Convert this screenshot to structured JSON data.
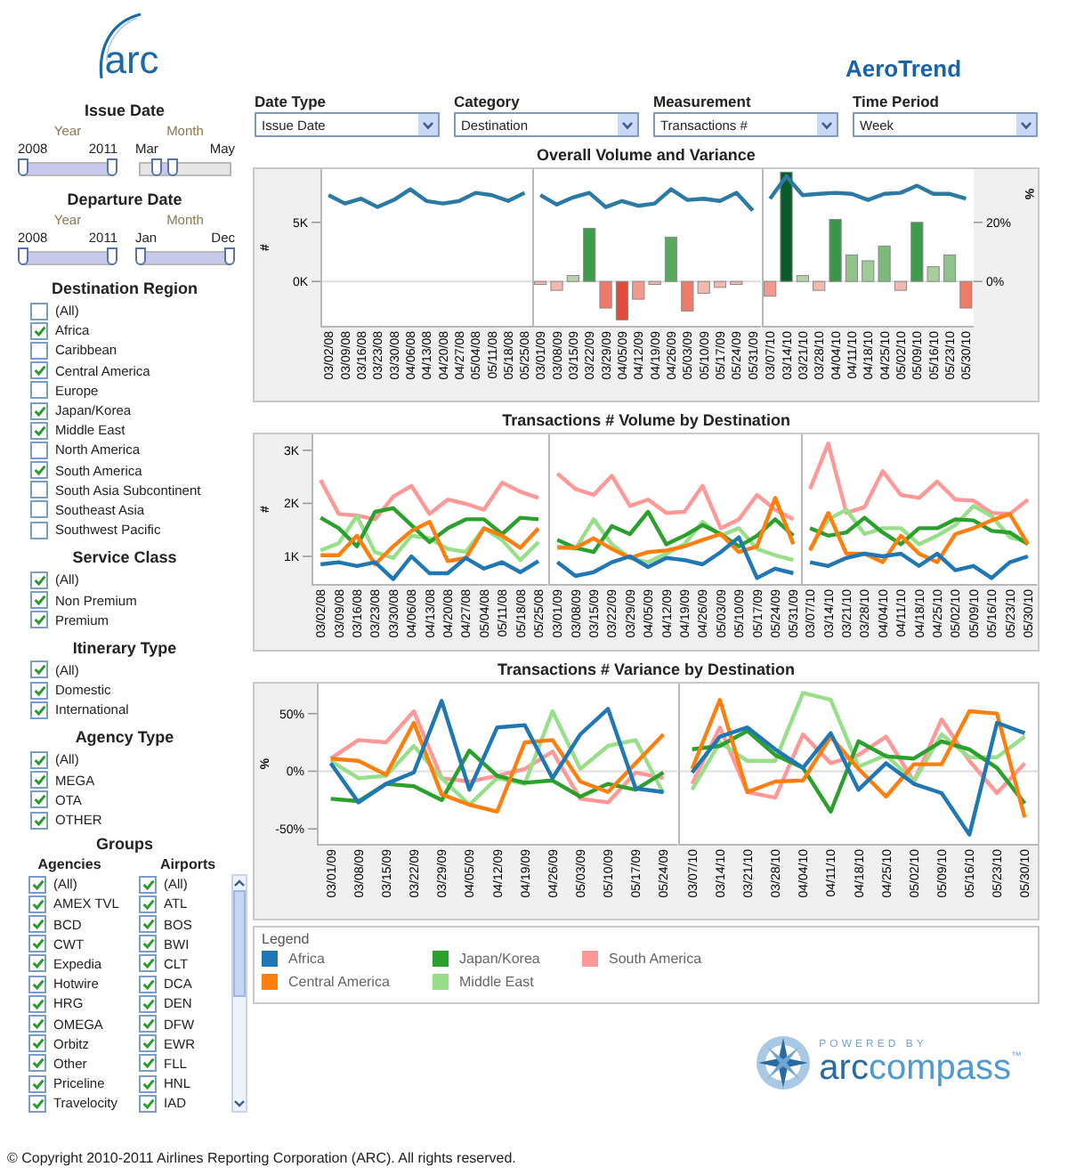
{
  "logo": {
    "text": "arc"
  },
  "app_title": "AeroTrend",
  "sidebar": {
    "date_filters": [
      {
        "title": "Issue Date",
        "sliders": [
          {
            "label": "Year",
            "min_label": "2008",
            "max_label": "2011",
            "thumbs": [
              {
                "level": 0
              },
              {
                "level": 1
              }
            ]
          },
          {
            "label": "Month",
            "min_label": "Mar",
            "max_label": "May",
            "thumbs": [
              {
                "level": 0.18
              },
              {
                "level": 0.36
              }
            ]
          }
        ]
      },
      {
        "title": "Departure Date",
        "sliders": [
          {
            "label": "Year",
            "min_label": "2008",
            "max_label": "2011",
            "thumbs": [
              {
                "level": 0
              },
              {
                "level": 1
              }
            ]
          },
          {
            "label": "Month",
            "min_label": "Jan",
            "max_label": "Dec",
            "thumbs": [
              {
                "level": 0
              },
              {
                "level": 1
              }
            ]
          }
        ]
      }
    ],
    "filters": [
      {
        "title": "Destination Region",
        "items": [
          {
            "label": "(All)",
            "checked": false
          },
          {
            "label": "Africa",
            "checked": true
          },
          {
            "label": "Caribbean",
            "checked": false
          },
          {
            "label": "Central America",
            "checked": true
          },
          {
            "label": "Europe",
            "checked": false
          },
          {
            "label": "Japan/Korea",
            "checked": true
          },
          {
            "label": "Middle East",
            "checked": true
          },
          {
            "label": "North America",
            "checked": false
          },
          {
            "label": "South America",
            "checked": true
          },
          {
            "label": "South Asia Subcontinent",
            "checked": false
          },
          {
            "label": "Southeast Asia",
            "checked": false
          },
          {
            "label": "Southwest Pacific",
            "checked": false
          }
        ]
      },
      {
        "title": "Service Class",
        "items": [
          {
            "label": "(All)",
            "checked": true
          },
          {
            "label": "Non Premium",
            "checked": true
          },
          {
            "label": "Premium",
            "checked": true
          }
        ]
      },
      {
        "title": "Itinerary Type",
        "items": [
          {
            "label": "(All)",
            "checked": true
          },
          {
            "label": "Domestic",
            "checked": true
          },
          {
            "label": "International",
            "checked": true
          }
        ]
      },
      {
        "title": "Agency Type",
        "items": [
          {
            "label": "(All)",
            "checked": true
          },
          {
            "label": "MEGA",
            "checked": true
          },
          {
            "label": "OTA",
            "checked": true
          },
          {
            "label": "OTHER",
            "checked": true
          }
        ]
      }
    ],
    "groups": {
      "title": "Groups",
      "columns": [
        {
          "title": "Agencies",
          "scrollable": false,
          "items": [
            {
              "label": "(All)",
              "checked": true
            },
            {
              "label": "AMEX TVL",
              "checked": true
            },
            {
              "label": "BCD",
              "checked": true
            },
            {
              "label": "CWT",
              "checked": true
            },
            {
              "label": "Expedia",
              "checked": true
            },
            {
              "label": "Hotwire",
              "checked": true
            },
            {
              "label": "HRG",
              "checked": true
            },
            {
              "label": "OMEGA",
              "checked": true
            },
            {
              "label": "Orbitz",
              "checked": true
            },
            {
              "label": "Other",
              "checked": true
            },
            {
              "label": "Priceline",
              "checked": true
            },
            {
              "label": "Travelocity",
              "checked": true
            }
          ]
        },
        {
          "title": "Airports",
          "scrollable": true,
          "items": [
            {
              "label": "(All)",
              "checked": true
            },
            {
              "label": "ATL",
              "checked": true
            },
            {
              "label": "BOS",
              "checked": true
            },
            {
              "label": "BWI",
              "checked": true
            },
            {
              "label": "CLT",
              "checked": true
            },
            {
              "label": "DCA",
              "checked": true
            },
            {
              "label": "DEN",
              "checked": true
            },
            {
              "label": "DFW",
              "checked": true
            },
            {
              "label": "EWR",
              "checked": true
            },
            {
              "label": "FLL",
              "checked": true
            },
            {
              "label": "HNL",
              "checked": true
            },
            {
              "label": "IAD",
              "checked": true
            }
          ]
        }
      ]
    }
  },
  "dropdowns": [
    {
      "label": "Date Type",
      "value": "Issue Date"
    },
    {
      "label": "Category",
      "value": "Destination"
    },
    {
      "label": "Measurement",
      "value": "Transactions #"
    },
    {
      "label": "Time Period",
      "value": "Week"
    }
  ],
  "charts": [
    {
      "title": "Overall Volume and Variance",
      "panels": [
        {
          "chart_data": {
            "type": "line",
            "ylabel": "#",
            "ylim": [
              -3.75,
              9.5
            ],
            "yticks": [
              {
                "value": 0,
                "label": "0K"
              },
              {
                "value": 5,
                "label": "5K"
              }
            ],
            "categories": [
              "03/02/08",
              "03/09/08",
              "03/16/08",
              "03/23/08",
              "03/30/08",
              "04/06/08",
              "04/13/08",
              "04/20/08",
              "04/27/08",
              "05/04/08",
              "05/11/08",
              "05/18/08",
              "05/25/08"
            ],
            "series": [
              {
                "color": "#2a7aa3",
                "values": [
                  7.3,
                  6.6,
                  7.0,
                  6.3,
                  6.9,
                  7.8,
                  6.8,
                  6.6,
                  6.8,
                  7.5,
                  7.3,
                  6.8,
                  7.5
                ]
              }
            ]
          }
        },
        {
          "chart_data": {
            "type": "bar",
            "ylim": [
              -3.75,
              9.5
            ],
            "y2lim": [
              -15,
              38
            ],
            "categories": [
              "03/01/09",
              "03/08/09",
              "03/15/09",
              "03/22/09",
              "03/29/09",
              "04/05/09",
              "04/12/09",
              "04/19/09",
              "04/26/09",
              "05/03/09",
              "05/10/09",
              "05/17/09",
              "05/24/09",
              "05/31/09"
            ],
            "series": [
              {
                "axis": "y2",
                "values": [
                  -1,
                  -3,
                  2,
                  18,
                  -9,
                  -13,
                  -6,
                  -1,
                  15,
                  -10,
                  -4,
                  -2,
                  -1,
                  null
                ],
                "colors": [
                  "#f2b8b0",
                  "#f2b8b0",
                  "#b5d3a8",
                  "#3f9b4c",
                  "#f07a6a",
                  "#e04b3a",
                  "#f29a8e",
                  "#f2b8b0",
                  "#58a85f",
                  "#f07a6a",
                  "#f2b8b0",
                  "#f2b8b0",
                  "#f2b8b0",
                  null
                ]
              },
              {
                "type": "line",
                "color": "#2a7aa3",
                "values": [
                  7.3,
                  6.5,
                  7.1,
                  7.5,
                  6.3,
                  6.8,
                  6.4,
                  6.6,
                  7.8,
                  6.9,
                  7.0,
                  6.8,
                  7.5,
                  6.0
                ]
              }
            ]
          }
        },
        {
          "chart_data": {
            "type": "bar",
            "ylim": [
              -3.75,
              9.5
            ],
            "y2lim": [
              -15,
              38
            ],
            "y2label": "%",
            "y2ticks": [
              {
                "value": 0,
                "label": "0%"
              },
              {
                "value": 20,
                "label": "20%"
              }
            ],
            "categories": [
              "03/07/10",
              "03/14/10",
              "03/21/10",
              "03/28/10",
              "04/04/10",
              "04/11/10",
              "04/18/10",
              "04/25/10",
              "05/02/10",
              "05/09/10",
              "05/16/10",
              "05/23/10",
              "05/30/10"
            ],
            "series": [
              {
                "axis": "y2",
                "values": [
                  -5,
                  37,
                  2,
                  -3,
                  21,
                  9,
                  7,
                  12,
                  -3,
                  20,
                  5,
                  9,
                  -9
                ],
                "colors": [
                  "#f29a8e",
                  "#0b5a2a",
                  "#b5d3a8",
                  "#f2b8b0",
                  "#3a964a",
                  "#8fc38a",
                  "#9ccb95",
                  "#7cb97a",
                  "#f2b8b0",
                  "#3f9b4c",
                  "#a8cf9a",
                  "#8fc38a",
                  "#f07a6a"
                ]
              },
              {
                "type": "line",
                "color": "#2a7aa3",
                "values": [
                  7.0,
                  8.9,
                  7.3,
                  7.4,
                  7.5,
                  7.4,
                  6.9,
                  7.4,
                  7.5,
                  8.1,
                  7.4,
                  7.4,
                  7.0
                ]
              }
            ]
          }
        }
      ]
    },
    {
      "title": "Transactions # Volume by Destination",
      "panels": [
        {
          "chart_data": {
            "type": "line",
            "ylabel": "#",
            "ylim": [
              0.48,
              3.3
            ],
            "yticks": [
              {
                "value": 1,
                "label": "1K"
              },
              {
                "value": 2,
                "label": "2K"
              },
              {
                "value": 3,
                "label": "3K"
              }
            ],
            "categories": [
              "03/02/08",
              "03/09/08",
              "03/16/08",
              "03/23/08",
              "03/30/08",
              "04/06/08",
              "04/13/08",
              "04/20/08",
              "04/27/08",
              "05/04/08",
              "05/11/08",
              "05/18/08",
              "05/25/08"
            ],
            "series": [
              {
                "color": "#ff9896",
                "values": [
                  2.44,
                  1.8,
                  1.77,
                  1.7,
                  2.13,
                  2.33,
                  1.8,
                  2.07,
                  1.99,
                  1.88,
                  2.39,
                  2.22,
                  2.1
                ]
              },
              {
                "color": "#98df8a",
                "values": [
                  1.11,
                  1.25,
                  1.76,
                  1.08,
                  0.97,
                  1.39,
                  1.34,
                  1.14,
                  1.08,
                  1.53,
                  1.31,
                  0.93,
                  1.27
                ]
              },
              {
                "color": "#2ca02c",
                "values": [
                  1.73,
                  1.53,
                  1.19,
                  1.84,
                  1.91,
                  1.59,
                  1.27,
                  1.53,
                  1.7,
                  1.7,
                  1.42,
                  1.73,
                  1.7
                ]
              },
              {
                "color": "#ff7f0e",
                "values": [
                  1.02,
                  1.02,
                  1.39,
                  0.85,
                  1.19,
                  1.48,
                  1.65,
                  0.91,
                  0.97,
                  1.53,
                  1.39,
                  1.16,
                  1.53
                ]
              },
              {
                "color": "#1f77b4",
                "values": [
                  0.85,
                  0.89,
                  0.82,
                  0.89,
                  0.57,
                  1.0,
                  0.68,
                  0.68,
                  0.97,
                  0.77,
                  0.89,
                  0.7,
                  0.91
                ]
              }
            ]
          }
        },
        {
          "chart_data": {
            "type": "line",
            "ylim": [
              0.48,
              3.3
            ],
            "categories": [
              "03/01/09",
              "03/08/09",
              "03/15/09",
              "03/22/09",
              "03/29/09",
              "04/05/09",
              "04/12/09",
              "04/19/09",
              "04/26/09",
              "05/03/09",
              "05/10/09",
              "05/17/09",
              "05/24/09",
              "05/31/09"
            ],
            "series": [
              {
                "color": "#ff9896",
                "values": [
                  2.56,
                  2.27,
                  2.16,
                  2.52,
                  1.95,
                  2.07,
                  1.82,
                  1.84,
                  2.33,
                  1.53,
                  1.7,
                  2.16,
                  1.88,
                  1.7
                ]
              },
              {
                "color": "#98df8a",
                "values": [
                  1.19,
                  1.14,
                  1.7,
                  1.23,
                  0.97,
                  0.89,
                  1.05,
                  1.23,
                  1.65,
                  1.39,
                  1.53,
                  1.14,
                  1.02,
                  0.93
                ]
              },
              {
                "color": "#2ca02c",
                "values": [
                  1.31,
                  1.16,
                  1.08,
                  1.57,
                  1.42,
                  1.84,
                  1.23,
                  1.39,
                  1.59,
                  1.42,
                  1.19,
                  1.39,
                  1.7,
                  1.39
                ]
              },
              {
                "color": "#ff7f0e",
                "values": [
                  1.16,
                  1.16,
                  1.34,
                  1.14,
                  0.97,
                  1.08,
                  1.11,
                  1.19,
                  1.31,
                  1.42,
                  1.08,
                  1.19,
                  2.1,
                  1.23
                ]
              },
              {
                "color": "#1f77b4",
                "values": [
                  0.89,
                  0.63,
                  0.7,
                  0.89,
                  1.0,
                  0.8,
                  0.97,
                  0.93,
                  0.85,
                  1.08,
                  1.36,
                  0.59,
                  0.77,
                  0.68
                ]
              }
            ]
          }
        },
        {
          "chart_data": {
            "type": "line",
            "ylim": [
              0.48,
              3.3
            ],
            "categories": [
              "03/07/10",
              "03/14/10",
              "03/21/10",
              "03/28/10",
              "04/04/10",
              "04/11/10",
              "04/18/10",
              "04/25/10",
              "05/02/10",
              "05/09/10",
              "05/16/10",
              "05/23/10",
              "05/30/10"
            ],
            "series": [
              {
                "color": "#ff9896",
                "values": [
                  2.27,
                  3.13,
                  1.82,
                  1.93,
                  2.61,
                  2.16,
                  2.1,
                  2.41,
                  2.07,
                  2.05,
                  1.82,
                  1.8,
                  2.07
                ]
              },
              {
                "color": "#98df8a",
                "values": [
                  1.14,
                  1.7,
                  1.88,
                  1.42,
                  1.53,
                  1.53,
                  1.23,
                  1.39,
                  1.59,
                  1.95,
                  1.76,
                  1.36,
                  1.27
                ]
              },
              {
                "color": "#2ca02c",
                "values": [
                  1.53,
                  1.39,
                  1.45,
                  1.73,
                  1.45,
                  1.23,
                  1.53,
                  1.53,
                  1.7,
                  1.68,
                  1.48,
                  1.45,
                  1.23
                ]
              },
              {
                "color": "#ff7f0e",
                "values": [
                  1.11,
                  1.82,
                  1.05,
                  1.05,
                  0.89,
                  1.39,
                  1.05,
                  0.89,
                  1.42,
                  1.53,
                  1.68,
                  1.8,
                  1.23
                ]
              },
              {
                "color": "#1f77b4",
                "values": [
                  0.89,
                  0.82,
                  0.97,
                  1.05,
                  1.0,
                  1.05,
                  0.82,
                  1.05,
                  0.74,
                  0.82,
                  0.59,
                  0.89,
                  1.0
                ]
              }
            ]
          }
        }
      ]
    },
    {
      "title": "Transactions # Variance by Destination",
      "panels": [
        {
          "chart_data": {
            "type": "line",
            "ylabel": "%",
            "ylim": [
              -63,
              76
            ],
            "yticks": [
              {
                "value": -50,
                "label": "-50%"
              },
              {
                "value": 0,
                "label": "0%"
              },
              {
                "value": 50,
                "label": "50%"
              }
            ],
            "categories": [
              "03/01/09",
              "03/08/09",
              "03/15/09",
              "03/22/09",
              "03/29/09",
              "04/05/09",
              "04/12/09",
              "04/19/09",
              "04/26/09",
              "05/03/09",
              "05/10/09",
              "05/17/09",
              "05/24/09"
            ],
            "series": [
              {
                "color": "#ff9896",
                "values": [
                  11,
                  27,
                  25,
                  52,
                  -6,
                  -9,
                  -4,
                  2,
                  17,
                  -24,
                  -27,
                  -1,
                  -6
                ]
              },
              {
                "color": "#98df8a",
                "values": [
                  9,
                  -6,
                  -4,
                  22,
                  -6,
                  -29,
                  -6,
                  -11,
                  52,
                  2,
                  22,
                  27,
                  -19
                ]
              },
              {
                "color": "#2ca02c",
                "values": [
                  -24,
                  -26,
                  -11,
                  -13,
                  -25,
                  18,
                  -4,
                  -10,
                  -8,
                  -22,
                  -11,
                  -16,
                  -1
                ]
              },
              {
                "color": "#ff7f0e",
                "values": [
                  11,
                  9,
                  -3,
                  42,
                  -20,
                  -29,
                  -35,
                  25,
                  27,
                  -9,
                  -18,
                  7,
                  32
                ]
              },
              {
                "color": "#1f77b4",
                "values": [
                  7,
                  -27,
                  -11,
                  -1,
                  61,
                  -16,
                  38,
                  40,
                  -6,
                  32,
                  54,
                  -15,
                  -18
                ]
              }
            ]
          }
        },
        {
          "chart_data": {
            "type": "line",
            "ylim": [
              -63,
              76
            ],
            "categories": [
              "03/07/10",
              "03/14/10",
              "03/21/10",
              "03/28/10",
              "04/04/10",
              "04/11/10",
              "04/18/10",
              "04/25/10",
              "05/02/10",
              "05/09/10",
              "05/16/10",
              "05/23/10",
              "05/30/10"
            ],
            "series": [
              {
                "color": "#ff9896",
                "values": [
                  -11,
                  38,
                  -18,
                  -23,
                  32,
                  7,
                  14,
                  30,
                  -9,
                  45,
                  9,
                  -19,
                  7
                ]
              },
              {
                "color": "#98df8a",
                "values": [
                  -16,
                  25,
                  9,
                  9,
                  68,
                  62,
                  4,
                  14,
                  -9,
                  32,
                  12,
                  12,
                  30
                ]
              },
              {
                "color": "#2ca02c",
                "values": [
                  19,
                  22,
                  35,
                  14,
                  3,
                  -35,
                  26,
                  13,
                  11,
                  26,
                  19,
                  3,
                  -28
                ]
              },
              {
                "color": "#ff7f0e",
                "values": [
                  2,
                  62,
                  -18,
                  -9,
                  -8,
                  30,
                  2,
                  -22,
                  6,
                  6,
                  52,
                  50,
                  -40
                ]
              },
              {
                "color": "#1f77b4",
                "values": [
                  -1,
                  30,
                  38,
                  19,
                  3,
                  33,
                  -16,
                  7,
                  -11,
                  -19,
                  -55,
                  42,
                  33
                ]
              }
            ]
          }
        }
      ]
    }
  ],
  "legend": {
    "title": "Legend",
    "items": [
      {
        "label": "Africa",
        "color": "#1f77b4"
      },
      {
        "label": "Central America",
        "color": "#ff7f0e"
      },
      {
        "label": "Japan/Korea",
        "color": "#2ca02c"
      },
      {
        "label": "Middle East",
        "color": "#98df8a"
      },
      {
        "label": "South America",
        "color": "#ff9896"
      }
    ]
  },
  "powered_by": {
    "caption": "POWERED BY",
    "wordmark": [
      "arc",
      "compass"
    ],
    "mark": "™"
  },
  "copyright": "© Copyright 2010-2011 Airlines Reporting Corporation (ARC). All rights reserved."
}
